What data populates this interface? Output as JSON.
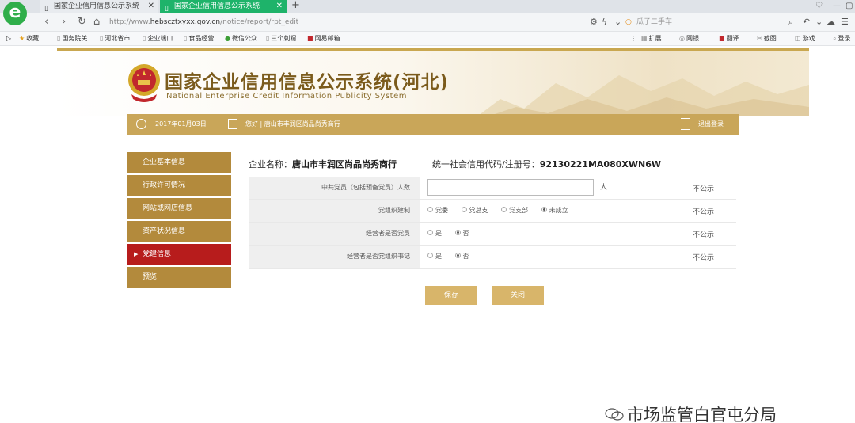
{
  "browser": {
    "logo": "e",
    "tabs": [
      {
        "label": "国家企业信用信息公示系统"
      },
      {
        "label": "国家企业信用信息公示系统"
      }
    ],
    "new_tab": "+",
    "url_prefix": "http://www.",
    "url_host": "hebscztxyxx.gov.cn",
    "url_path": "/notice/report/rpt_edit",
    "search_text": "瓜子二手车",
    "bookmarks": [
      "收藏",
      "国务院关",
      "河北省市",
      "企业端口",
      "食品经营",
      "微信公众",
      "三个刺猬",
      "网易邮箱"
    ],
    "right_tools": [
      "扩展",
      "网银",
      "翻译",
      "截图",
      "游戏",
      "登录"
    ]
  },
  "site": {
    "title": "国家企业信用信息公示系统(河北)",
    "subtitle": "National Enterprise Credit Information Publicity System"
  },
  "status": {
    "date": "2017年01月03日",
    "greeting": "您好 | 唐山市丰润区尚品尚秀商行",
    "logout": "退出登录"
  },
  "sidebar": [
    {
      "label": "企业基本信息",
      "active": false
    },
    {
      "label": "行政许可情况",
      "active": false
    },
    {
      "label": "网站或网店信息",
      "active": false
    },
    {
      "label": "资产状况信息",
      "active": false
    },
    {
      "label": "党建信息",
      "active": true
    },
    {
      "label": "预览",
      "active": false
    }
  ],
  "company": {
    "name_label": "企业名称：",
    "name": "唐山市丰润区尚品尚秀商行",
    "credit_label": "统一社会信用代码/注册号：",
    "credit_code": "92130221MA080XWN6W"
  },
  "form": {
    "rows": [
      {
        "label": "中共党员（包括预备党员）人数",
        "unit": "人",
        "public": "不公示"
      },
      {
        "label": "党组织建制",
        "options": [
          "党委",
          "党总支",
          "党支部",
          "未成立"
        ],
        "selected": 3,
        "public": "不公示"
      },
      {
        "label": "经营者是否党员",
        "options": [
          "是",
          "否"
        ],
        "selected": 1,
        "public": "不公示"
      },
      {
        "label": "经营者是否党组织书记",
        "options": [
          "是",
          "否"
        ],
        "selected": 1,
        "public": "不公示"
      }
    ]
  },
  "buttons": {
    "save": "保存",
    "close": "关闭"
  },
  "watermark": "市场监管白官屯分局"
}
